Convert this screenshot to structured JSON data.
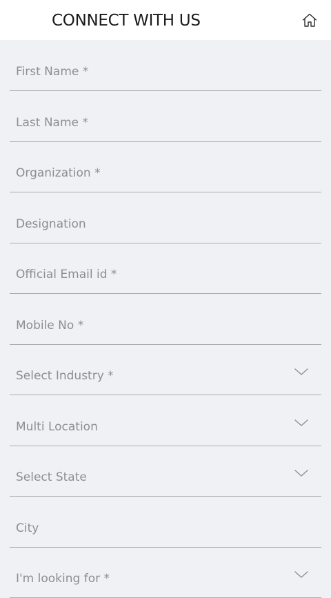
{
  "header": {
    "title": "CONNECT WITH US",
    "home_icon": "home-icon"
  },
  "form": {
    "fields": [
      {
        "name": "first-name-input",
        "type": "text",
        "placeholder": "First Name *",
        "value": ""
      },
      {
        "name": "last-name-input",
        "type": "text",
        "placeholder": "Last Name *",
        "value": ""
      },
      {
        "name": "organization-input",
        "type": "text",
        "placeholder": "Organization *",
        "value": ""
      },
      {
        "name": "designation-input",
        "type": "text",
        "placeholder": "Designation",
        "value": ""
      },
      {
        "name": "official-email-input",
        "type": "email",
        "placeholder": "Official Email id *",
        "value": ""
      },
      {
        "name": "mobile-no-input",
        "type": "tel",
        "placeholder": "Mobile No *",
        "value": ""
      },
      {
        "name": "select-industry-dropdown",
        "type": "select",
        "selected": "Select Industry *"
      },
      {
        "name": "multi-location-dropdown",
        "type": "select",
        "selected": "Multi Location"
      },
      {
        "name": "select-state-dropdown",
        "type": "select",
        "selected": "Select State"
      },
      {
        "name": "city-input",
        "type": "text",
        "placeholder": "City",
        "value": ""
      },
      {
        "name": "looking-for-dropdown",
        "type": "select",
        "selected": "I'm looking for *"
      }
    ]
  },
  "colors": {
    "background": "#f0f1f5",
    "header_background": "#ffffff",
    "placeholder_text": "#8c8e94",
    "divider": "#a9acb4",
    "title_text": "#1a1a1a"
  }
}
